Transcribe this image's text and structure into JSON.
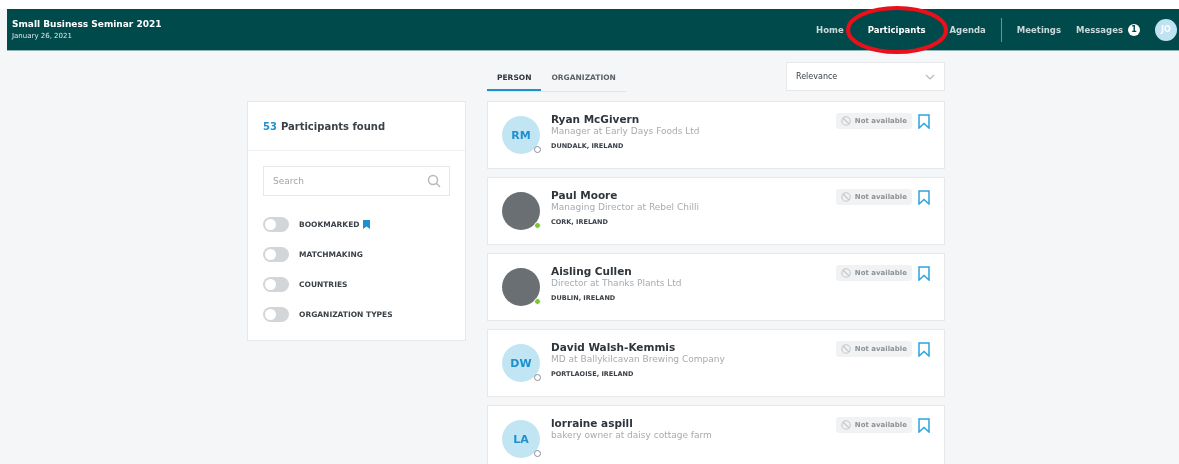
{
  "header": {
    "title": "Small Business Seminar 2021",
    "date": "January 26, 2021",
    "nav": [
      {
        "label": "Home",
        "selected": false
      },
      {
        "label": "Participants",
        "selected": true
      },
      {
        "label": "Agenda",
        "selected": false
      }
    ],
    "nav_right": [
      {
        "label": "Meetings"
      },
      {
        "label": "Messages",
        "badge": "1"
      }
    ],
    "avatar": "JO"
  },
  "tabs": [
    {
      "label": "PERSON",
      "selected": true
    },
    {
      "label": "ORGANIZATION",
      "selected": false
    }
  ],
  "sort": {
    "value": "Relevance"
  },
  "filters": {
    "count": "53",
    "count_label": "Participants found",
    "search": {
      "placeholder": "Search"
    },
    "toggles": [
      {
        "label": "BOOKMARKED",
        "on": false,
        "bookmark_icon": true
      },
      {
        "label": "MATCHMAKING",
        "on": false,
        "bookmark_icon": false
      },
      {
        "label": "COUNTRIES",
        "on": false,
        "bookmark_icon": false
      },
      {
        "label": "ORGANIZATION TYPES",
        "on": false,
        "bookmark_icon": false
      }
    ]
  },
  "participants": [
    {
      "name": "Ryan McGivern",
      "role": "Manager at Early Days Foods Ltd",
      "location": "DUNDALK, IRELAND",
      "avatar": {
        "kind": "initials",
        "text": "RM"
      },
      "online": false,
      "status": "Not available"
    },
    {
      "name": "Paul Moore",
      "role": "Managing Director at Rebel Chilli",
      "location": "CORK, IRELAND",
      "avatar": {
        "kind": "photo"
      },
      "online": true,
      "status": "Not available"
    },
    {
      "name": "Aisling Cullen",
      "role": "Director at Thanks Plants Ltd",
      "location": "DUBLIN, IRELAND",
      "avatar": {
        "kind": "photo"
      },
      "online": true,
      "status": "Not available"
    },
    {
      "name": "David Walsh-Kemmis",
      "role": "MD at Ballykilcavan Brewing Company",
      "location": "PORTLAOISE, IRELAND",
      "avatar": {
        "kind": "initials",
        "text": "DW"
      },
      "online": false,
      "status": "Not available"
    },
    {
      "name": "lorraine aspill",
      "role": "bakery owner at daisy cottage farm",
      "avatar": {
        "kind": "initials",
        "text": "LA"
      },
      "online": false,
      "status": "Not available"
    }
  ]
}
